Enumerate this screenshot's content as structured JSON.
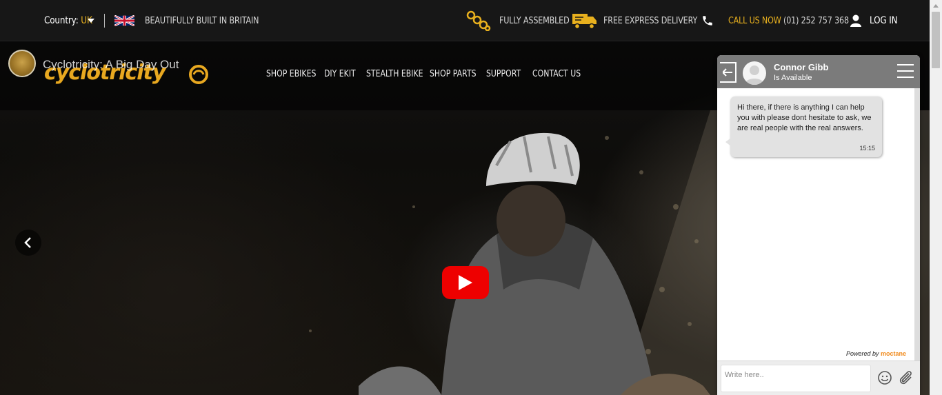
{
  "topbar": {
    "country_label": "Country:",
    "country_value": "UK",
    "tagline": "BEAUTIFULLY BUILT IN BRITAIN",
    "assembled": "FULLY ASSEMBLED",
    "delivery": "FREE EXPRESS DELIVERY",
    "call_label": "CALL US NOW",
    "phone": "(01) 252 757 368",
    "login": "LOG IN"
  },
  "video": {
    "title": "Cyclotricity: A Big Day Out"
  },
  "logo": {
    "text": "cyclotricity"
  },
  "nav": {
    "items": [
      {
        "label": "SHOP EBIKES"
      },
      {
        "label": "DIY EKIT"
      },
      {
        "label": "STEALTH EBIKE"
      },
      {
        "label": "SHOP PARTS"
      },
      {
        "label": "SUPPORT"
      },
      {
        "label": "CONTACT US"
      }
    ]
  },
  "chat": {
    "agent_name": "Connor Gibb",
    "agent_status": "Is Available",
    "message": "Hi there, if there is anything I can help you with please dont hesitate to ask, we are real people with the real answers.",
    "message_time": "15:15",
    "powered_by": "Powered by",
    "powered_brand": "moctane",
    "input_placeholder": "Write here.."
  },
  "colors": {
    "accent_gold": "#e8b01e",
    "youtube_red": "#e00000",
    "chat_header": "#7b7b7b"
  },
  "icons": [
    "chevron-down-icon",
    "uk-flag-icon",
    "chain-icon",
    "truck-icon",
    "phone-icon",
    "user-icon",
    "chevron-left-icon",
    "play-icon",
    "back-arrow-icon",
    "menu-icon",
    "emoji-icon",
    "paperclip-icon"
  ]
}
